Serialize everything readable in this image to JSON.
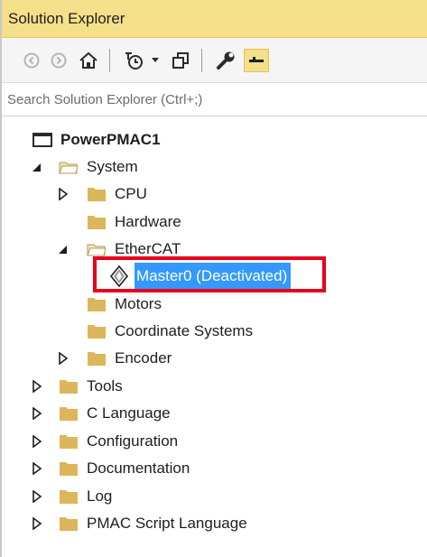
{
  "title": "Solution Explorer",
  "search": {
    "placeholder": "Search Solution Explorer (Ctrl+;)"
  },
  "toolbar": {
    "buttons": [
      "back-icon",
      "forward-icon",
      "home-icon",
      "pending-changes-icon",
      "dropdown-icon",
      "sync-windows-icon",
      "properties-wrench-icon",
      "collapse-all-icon"
    ]
  },
  "tree": {
    "root": "PowerPMAC1",
    "system": "System",
    "cpu": "CPU",
    "hardware": "Hardware",
    "ethercat": "EtherCAT",
    "master": "Master0 (Deactivated)",
    "motors": "Motors",
    "coord": "Coordinate Systems",
    "encoder": "Encoder",
    "tools": "Tools",
    "clang": "C Language",
    "config": "Configuration",
    "docs": "Documentation",
    "log": "Log",
    "script": "PMAC Script Language"
  },
  "colors": {
    "title_bg": "#f4df8a",
    "selection": "#3399ff",
    "highlight_border": "#e8001b",
    "folder": "#dcb65a"
  }
}
